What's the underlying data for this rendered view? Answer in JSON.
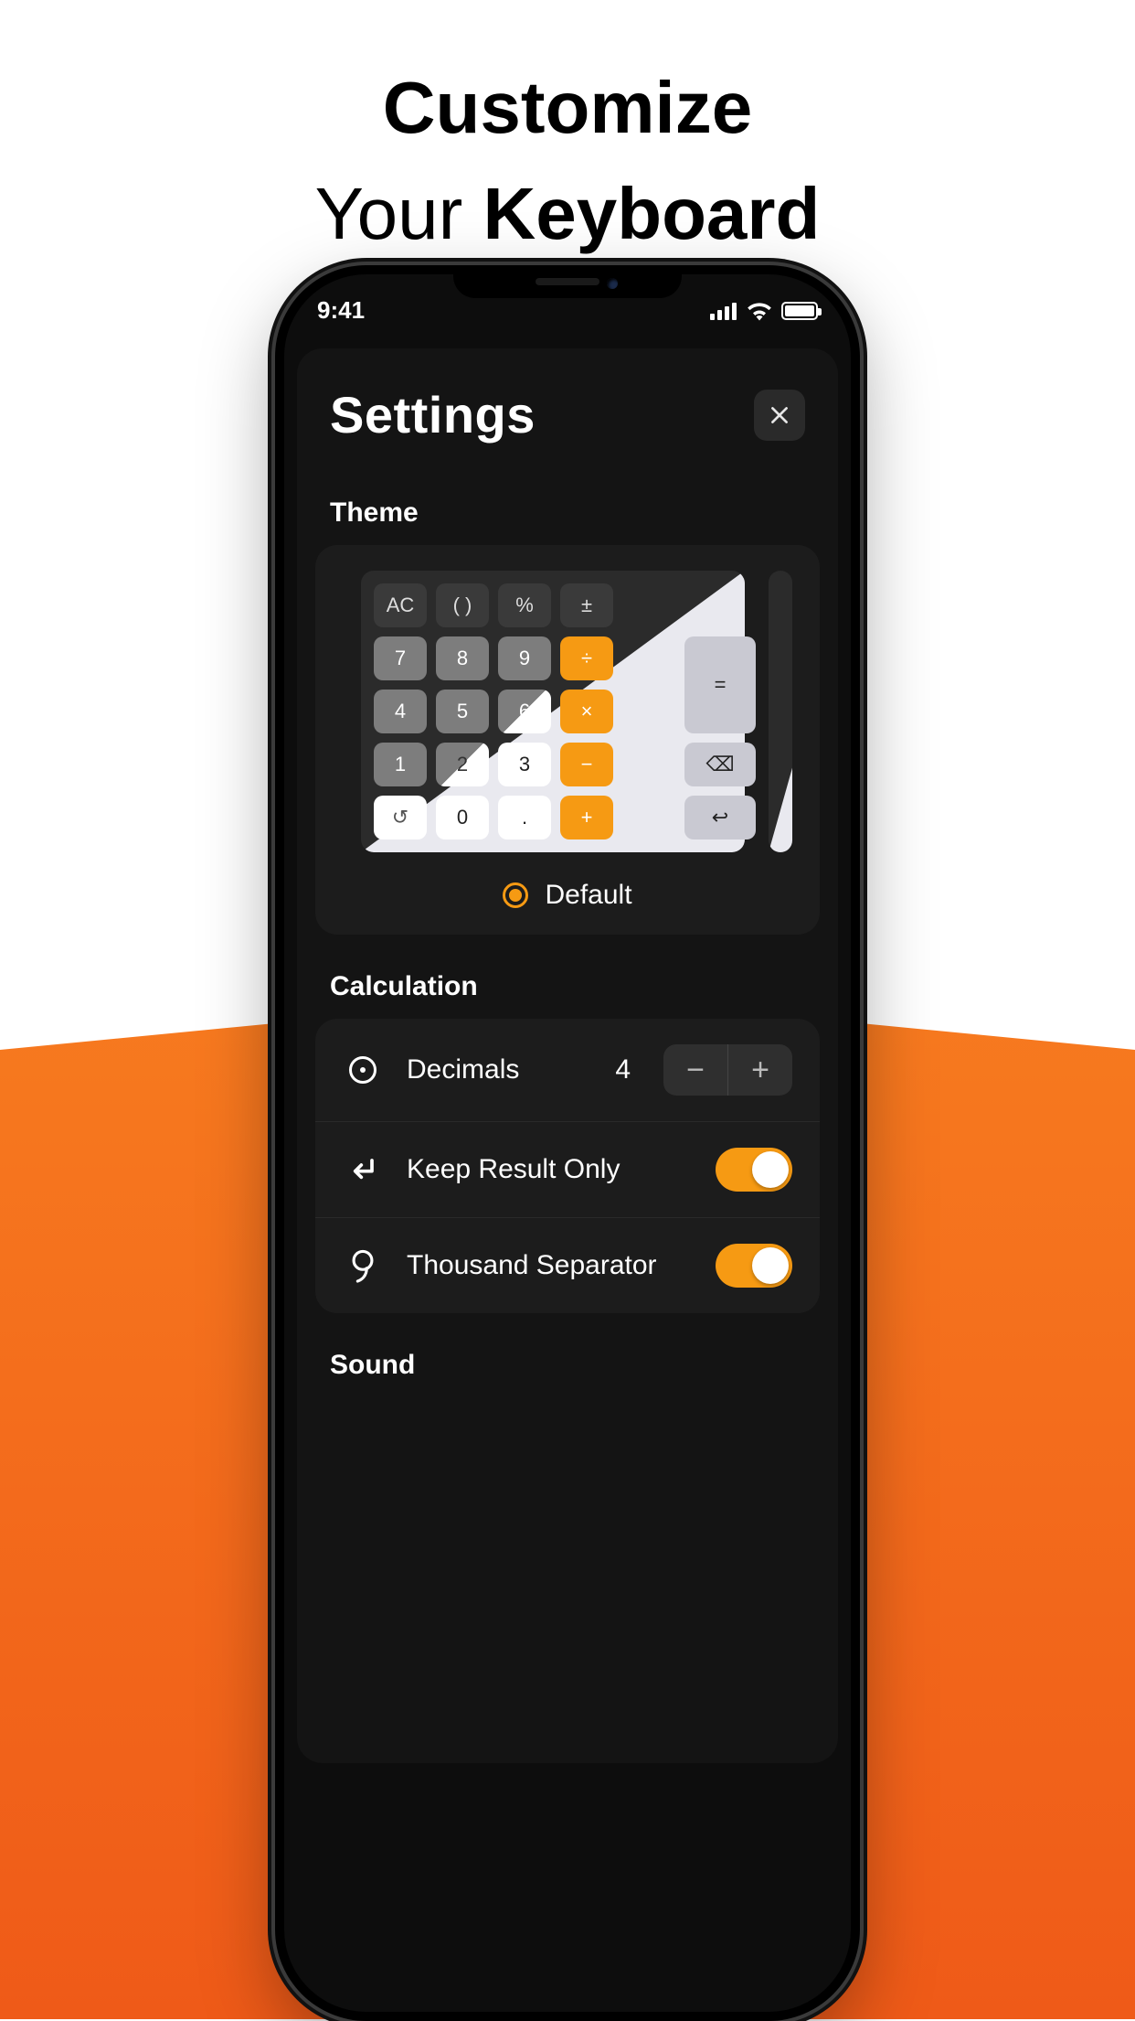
{
  "promo": {
    "line1": "Customize",
    "line2a": "Your ",
    "line2b": "Keyboard"
  },
  "status": {
    "time": "9:41"
  },
  "sheet": {
    "title": "Settings"
  },
  "theme": {
    "section_label": "Theme",
    "selected_label": "Default",
    "keys": {
      "ac": "AC",
      "paren": "( )",
      "percent": "%",
      "plusminus": "±",
      "k7": "7",
      "k8": "8",
      "k9": "9",
      "div": "÷",
      "eq": "=",
      "k4": "4",
      "k5": "5",
      "k6": "6",
      "mul": "×",
      "k1": "1",
      "k2": "2",
      "k3": "3",
      "minus": "−",
      "undo": "↺",
      "k0": "0",
      "dot": ".",
      "plus": "+",
      "backspace": "⌫",
      "enter": "↩"
    }
  },
  "calculation": {
    "section_label": "Calculation",
    "decimals_label": "Decimals",
    "decimals_value": "4",
    "keep_result_label": "Keep Result Only",
    "thousand_label": "Thousand Separator"
  },
  "sound": {
    "section_label": "Sound"
  }
}
